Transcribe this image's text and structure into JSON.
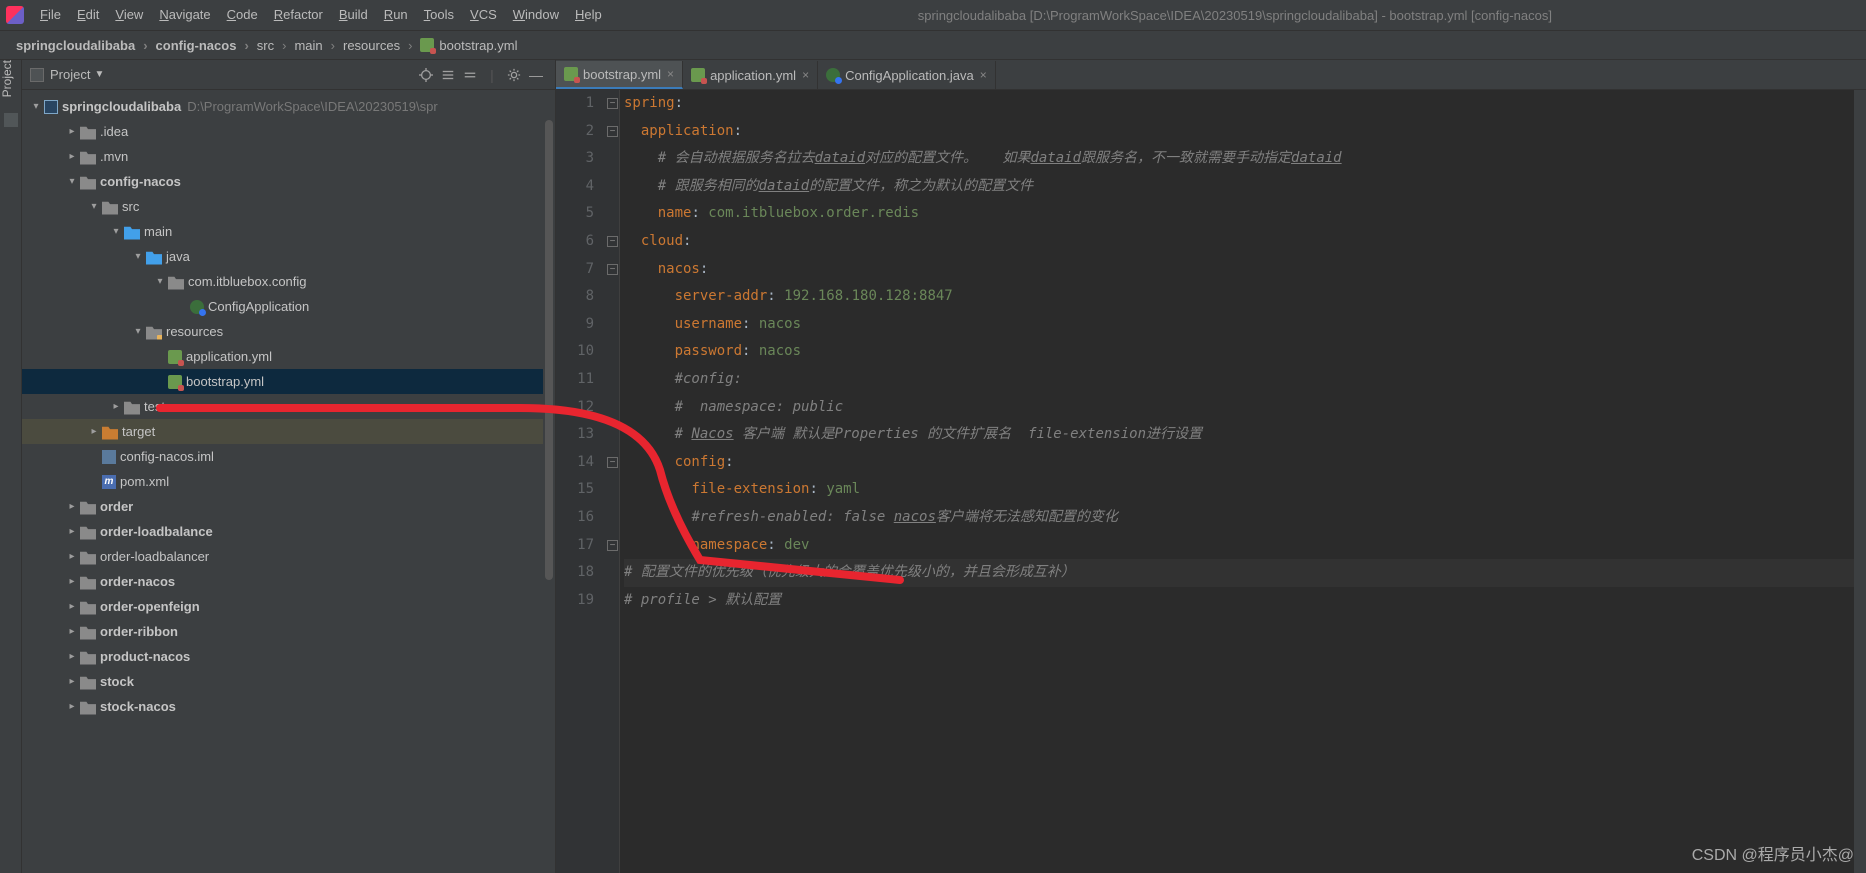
{
  "window_title": "springcloudalibaba [D:\\ProgramWorkSpace\\IDEA\\20230519\\springcloudalibaba] - bootstrap.yml [config-nacos]",
  "menu": [
    "File",
    "Edit",
    "View",
    "Navigate",
    "Code",
    "Refactor",
    "Build",
    "Run",
    "Tools",
    "VCS",
    "Window",
    "Help"
  ],
  "crumbs": [
    "springcloudalibaba",
    "config-nacos",
    "src",
    "main",
    "resources",
    "bootstrap.yml"
  ],
  "project_panel": {
    "title": "Project",
    "root": {
      "name": "springcloudalibaba",
      "path": "D:\\ProgramWorkSpace\\IDEA\\20230519\\spr"
    },
    "tree": [
      {
        "d": 1,
        "a": "right",
        "i": "folder",
        "t": ".idea"
      },
      {
        "d": 1,
        "a": "right",
        "i": "folder",
        "t": ".mvn"
      },
      {
        "d": 1,
        "a": "down",
        "i": "folder",
        "t": "config-nacos",
        "bold": true
      },
      {
        "d": 2,
        "a": "down",
        "i": "folder",
        "t": "src"
      },
      {
        "d": 3,
        "a": "down",
        "i": "folder-blue",
        "t": "main"
      },
      {
        "d": 4,
        "a": "down",
        "i": "folder-blue",
        "t": "java"
      },
      {
        "d": 5,
        "a": "down",
        "i": "folder",
        "t": "com.itbluebox.config"
      },
      {
        "d": 6,
        "a": "blank",
        "i": "class-icon",
        "t": "ConfigApplication"
      },
      {
        "d": 4,
        "a": "down",
        "i": "folder-res",
        "t": "resources"
      },
      {
        "d": 5,
        "a": "blank",
        "i": "yml",
        "t": "application.yml"
      },
      {
        "d": 5,
        "a": "blank",
        "i": "yml",
        "t": "bootstrap.yml",
        "sel": true
      },
      {
        "d": 3,
        "a": "right",
        "i": "folder",
        "t": "test"
      },
      {
        "d": 2,
        "a": "right",
        "i": "folder-orange",
        "t": "target",
        "hl": true
      },
      {
        "d": 2,
        "a": "blank",
        "i": "iml-icon",
        "t": "config-nacos.iml"
      },
      {
        "d": 2,
        "a": "blank",
        "i": "pom-icon",
        "t": "pom.xml"
      },
      {
        "d": 1,
        "a": "right",
        "i": "folder",
        "t": "order",
        "bold": true
      },
      {
        "d": 1,
        "a": "right",
        "i": "folder",
        "t": "order-loadbalance",
        "bold": true
      },
      {
        "d": 1,
        "a": "right",
        "i": "folder",
        "t": "order-loadbalancer"
      },
      {
        "d": 1,
        "a": "right",
        "i": "folder",
        "t": "order-nacos",
        "bold": true
      },
      {
        "d": 1,
        "a": "right",
        "i": "folder",
        "t": "order-openfeign",
        "bold": true
      },
      {
        "d": 1,
        "a": "right",
        "i": "folder",
        "t": "order-ribbon",
        "bold": true
      },
      {
        "d": 1,
        "a": "right",
        "i": "folder",
        "t": "product-nacos",
        "bold": true
      },
      {
        "d": 1,
        "a": "right",
        "i": "folder",
        "t": "stock",
        "bold": true
      },
      {
        "d": 1,
        "a": "right",
        "i": "folder",
        "t": "stock-nacos",
        "bold": true
      }
    ]
  },
  "tabs": [
    {
      "icon": "yml",
      "label": "bootstrap.yml",
      "active": true
    },
    {
      "icon": "yml",
      "label": "application.yml"
    },
    {
      "icon": "class-icon",
      "label": "ConfigApplication.java"
    }
  ],
  "code": {
    "lines": [
      {
        "n": 1,
        "html": "<span class='k'>spring</span>:"
      },
      {
        "n": 2,
        "html": "  <span class='k'>application</span>:"
      },
      {
        "n": 3,
        "html": "    <span class='c'># 会自动根据服务名拉去</span><span class='cu'>dataid</span><span class='c'>对应的配置文件。   如果</span><span class='cu'>dataid</span><span class='c'>跟服务名，不一致就需要手动指定</span><span class='cu'>dataid</span>"
      },
      {
        "n": 4,
        "html": "    <span class='c'># 跟服务相同的</span><span class='cu'>dataid</span><span class='c'>的配置文件，称之为默认的配置文件</span>"
      },
      {
        "n": 5,
        "html": "    <span class='k'>name</span>: <span class='v'>com.itbluebox.order.redis</span>"
      },
      {
        "n": 6,
        "html": "  <span class='k'>cloud</span>:"
      },
      {
        "n": 7,
        "html": "    <span class='k'>nacos</span>:"
      },
      {
        "n": 8,
        "html": "      <span class='k'>server-addr</span>: <span class='v'>192.168.180.128:8847</span>"
      },
      {
        "n": 9,
        "html": "      <span class='k'>username</span>: <span class='v'>nacos</span>"
      },
      {
        "n": 10,
        "html": "      <span class='k'>password</span>: <span class='v'>nacos</span>"
      },
      {
        "n": 11,
        "html": "      <span class='c'>#config:</span>"
      },
      {
        "n": 12,
        "html": "      <span class='c'>#  namespace: public</span>"
      },
      {
        "n": 13,
        "html": "      <span class='c'># </span><span class='cu'>Nacos</span><span class='c'> 客户端 默认是Properties 的文件扩展名  file-extension进行设置</span>"
      },
      {
        "n": 14,
        "html": "      <span class='k'>config</span>:"
      },
      {
        "n": 15,
        "html": "        <span class='k'>file-extension</span>: <span class='v'>yaml</span>"
      },
      {
        "n": 16,
        "html": "        <span class='c'>#refresh-enabled: false </span><span class='cu'>nacos</span><span class='c'>客户端将无法感知配置的变化</span>"
      },
      {
        "n": 17,
        "html": "        <span class='k'>namespace</span>: <span class='v'>dev</span>"
      },
      {
        "n": 18,
        "html": "<span class='c'># 配置文件的优先级（优先级大的会覆盖优先级小的，并且会形成互补）</span>",
        "current": true
      },
      {
        "n": 19,
        "html": "<span class='c'># profile > 默认配置</span>"
      }
    ],
    "folds": [
      1,
      2,
      6,
      7,
      14,
      17
    ]
  },
  "watermark": "CSDN @程序员小杰@"
}
